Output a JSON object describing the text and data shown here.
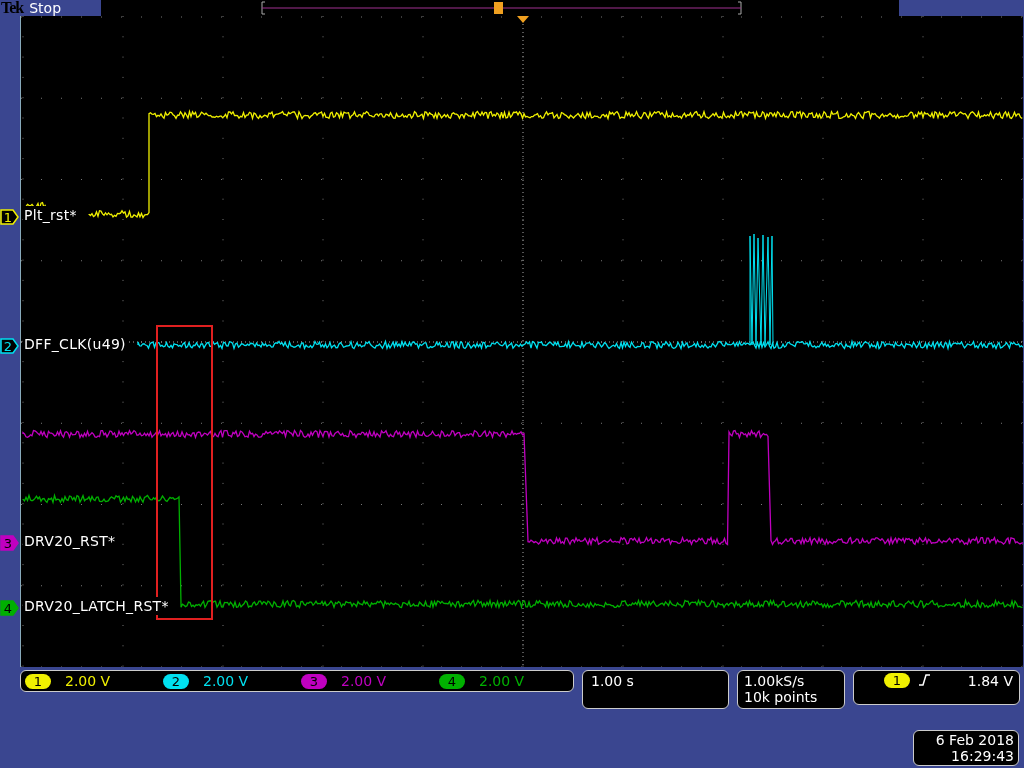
{
  "header": {
    "brand": "Tek",
    "status": "Stop"
  },
  "channels": [
    {
      "marker_number": "1",
      "label": "Plt_rst*",
      "badge_number": "1",
      "scale": "2.00 V",
      "color": "#f0f000"
    },
    {
      "marker_number": "2",
      "label": "DFF_CLK(u49)",
      "badge_number": "2",
      "scale": "2.00 V",
      "color": "#00e0f0"
    },
    {
      "marker_number": "3",
      "label": "DRV20_RST*",
      "badge_number": "3",
      "scale": "2.00 V",
      "color": "#c000c0"
    },
    {
      "marker_number": "4",
      "label": "DRV20_LATCH_RST*",
      "badge_number": "4",
      "scale": "2.00 V",
      "color": "#00b000"
    }
  ],
  "timebase": {
    "scale": "1.00 s"
  },
  "acquisition": {
    "sample_rate": "1.00kS/s",
    "record_length": "10k points"
  },
  "trigger": {
    "source": "1",
    "level": "1.84 V"
  },
  "datetime": {
    "date": "6 Feb 2018",
    "time": "16:29:43"
  }
}
